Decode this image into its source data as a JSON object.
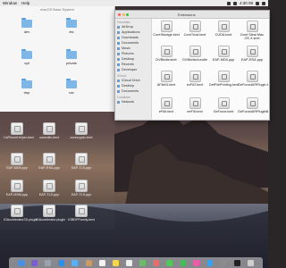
{
  "menubar": {
    "items": [
      "Window",
      "Help"
    ],
    "clock": "4:30 08"
  },
  "back_window": {
    "title": "macOS Base System",
    "folders": [
      "dev",
      "etc",
      "opt",
      "private",
      "tmp",
      "var"
    ]
  },
  "desktop_icons": [
    "CsPhoneHelper.kext",
    "coreutils.kext",
    "corecrypto.kext",
    "EAP-MD5.ppp",
    "EAP-RSA.ppp",
    "EAP-TLS.ppp",
    "EAP-MSM.ppp",
    "EAP-TLS.ppp",
    "EAP-TLS.ppp",
    "IOAccelerator2D.plugin",
    "IOAccelerator.plugin",
    "IOBDPFamily.kext"
  ],
  "finder": {
    "title": "Extensions",
    "sidebar": {
      "favorites_label": "Favorites",
      "favorites": [
        "AirDrop",
        "Applications",
        "Downloads",
        "Documents",
        "Music",
        "Pictures",
        "Desktop",
        "Recents",
        "Developer"
      ],
      "cloud_label": "iCloud",
      "cloud": [
        "iCloud Drive",
        "Desktop",
        "Documents"
      ],
      "locations_label": "Locations",
      "locations": [
        "Network"
      ]
    },
    "files": [
      "CoreStorage.kext",
      "CoreTrust.kext",
      "CUDA.kext",
      "Dont Steal Mac OS X.kext",
      "DVBkxfw.kext",
      "DVBkxfw.bundle",
      "EAP-MD5.ppp",
      "EAP-RSA.ppp",
      "AFileID.kext",
      "exFAT.kext",
      "DefFilePrinting.kext",
      "GeForceAIRPlugin.bundle",
      "eFiltr.kext",
      "eeFilt.kext",
      "GeForce.kext",
      "GeForceAIRPluginBundle",
      "GeForceGLDriver",
      "GeForceVADriver",
      "GeForceTesla.kext",
      "GeForceTeslaVAD"
    ]
  },
  "colors": {
    "folder": "#7fb6e8",
    "sidebar_icon": "#5a9fd9",
    "close": "#ff5f57",
    "minimize": "#febc2e",
    "zoom": "#28c840"
  },
  "dock_apps": [
    "finder",
    "siri",
    "launchpad",
    "safari",
    "mail",
    "contacts",
    "calendar",
    "notes",
    "reminders",
    "maps",
    "photos",
    "messages",
    "facetime",
    "itunes",
    "app-store",
    "preferences",
    "terminal",
    "trash"
  ]
}
